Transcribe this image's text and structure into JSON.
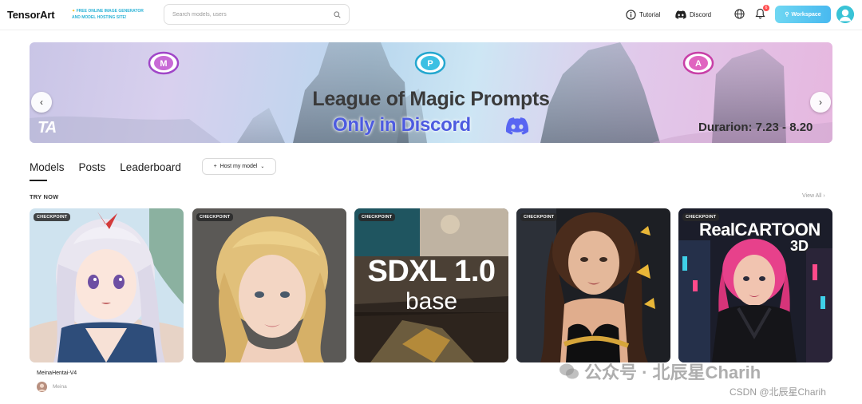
{
  "header": {
    "logo": "TensorArt",
    "tagline_line1": "FREE ONLINE IMAGE GENERATOR",
    "tagline_line2": "AND MODEL HOSTING SITE!",
    "search_placeholder": "Search models, users",
    "tutorial_label": "Tutorial",
    "discord_label": "Discord",
    "notification_count": "6",
    "workspace_label": "Workspace"
  },
  "banner": {
    "title": "League of Magic Prompts",
    "subtitle": "Only in Discord",
    "duration": "Durarion: 7.23 - 8.20",
    "brand_mark": "TA",
    "badges": [
      "M",
      "P",
      "A"
    ]
  },
  "tabs": [
    {
      "label": "Models",
      "active": true
    },
    {
      "label": "Posts",
      "active": false
    },
    {
      "label": "Leaderboard",
      "active": false
    }
  ],
  "host_button": "Host my model",
  "section": {
    "title": "TRY NOW",
    "view_all": "View All"
  },
  "cards": [
    {
      "badge": "CHECKPOINT",
      "name": "MeinaHentai-V4",
      "author": "Meina"
    },
    {
      "badge": "CHECKPOINT"
    },
    {
      "badge": "CHECKPOINT",
      "overlay_title": "SDXL 1.0",
      "overlay_sub": "base"
    },
    {
      "badge": "CHECKPOINT"
    },
    {
      "badge": "CHECKPOINT",
      "overlay_title": "RealCARTOON",
      "overlay_sub": "3D"
    }
  ],
  "watermarks": {
    "wechat": "公众号 · 北辰星Charih",
    "csdn": "CSDN @北辰星Charih"
  },
  "colors": {
    "accent": "#48b9f0",
    "discord_blue": "#4d5be0",
    "notification_red": "#ff4d4f"
  },
  "icons": [
    "search-icon",
    "info-circle-icon",
    "discord-icon",
    "globe-icon",
    "bell-icon",
    "wand-icon",
    "plus-icon",
    "chevron-down-icon",
    "chevron-right-icon",
    "arrow-left-icon",
    "arrow-right-icon"
  ]
}
